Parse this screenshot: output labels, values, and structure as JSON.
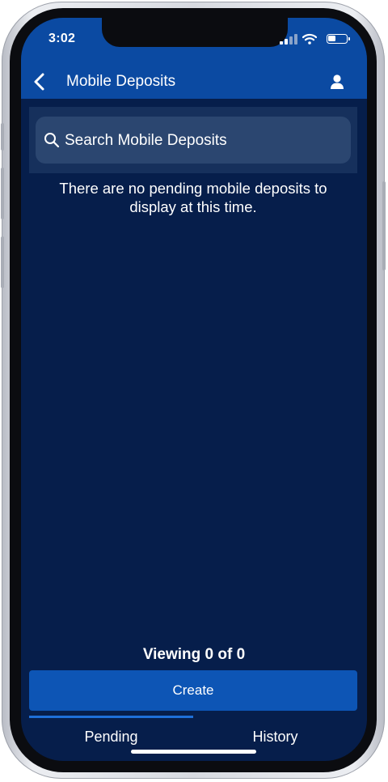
{
  "status_bar": {
    "time": "3:02",
    "icons": [
      "cellular-signal-icon",
      "wifi-icon",
      "battery-icon"
    ]
  },
  "header": {
    "title": "Mobile Deposits",
    "back_icon": "chevron-left-icon",
    "profile_icon": "person-icon"
  },
  "search": {
    "placeholder": "Search Mobile Deposits",
    "value": "",
    "icon": "search-icon"
  },
  "main": {
    "empty_message": "There are no pending mobile deposits to display at this time."
  },
  "footer": {
    "viewing_text": "Viewing 0 of 0",
    "create_label": "Create"
  },
  "tabs": [
    {
      "label": "Pending",
      "active": true
    },
    {
      "label": "History",
      "active": false
    }
  ],
  "colors": {
    "header_blue": "#0b4aa2",
    "background_navy": "#061e4b",
    "button_blue": "#0d55b5",
    "tab_indicator": "#1e6fd9"
  }
}
